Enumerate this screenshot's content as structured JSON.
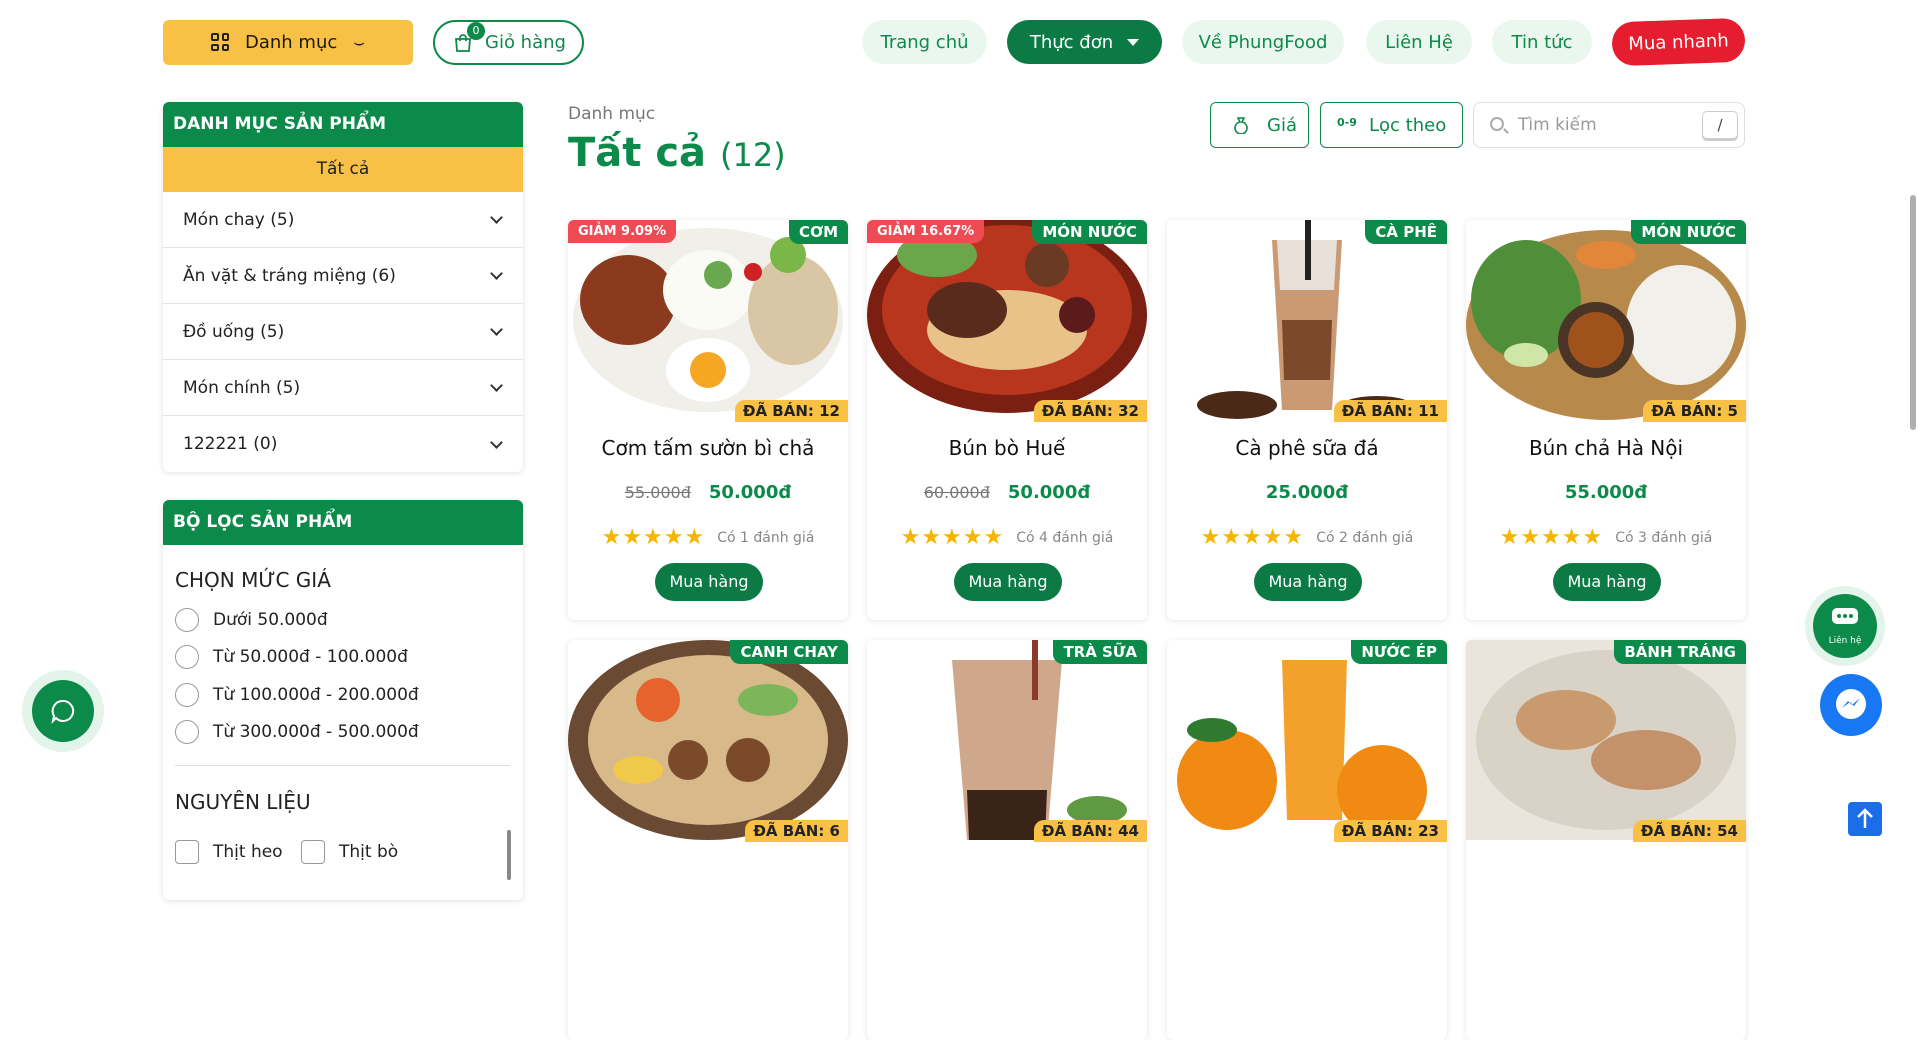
{
  "header": {
    "category_label": "Danh mục",
    "cart_label": "Giỏ hàng",
    "cart_count": "0",
    "nav": [
      {
        "label": "Trang chủ"
      },
      {
        "label": "Thực đơn"
      },
      {
        "label": "Về PhungFood"
      },
      {
        "label": "Liên Hệ"
      },
      {
        "label": "Tin tức"
      },
      {
        "label": "Mua nhanh"
      }
    ]
  },
  "sidebar": {
    "title": "DANH MỤC SẢN PHẨM",
    "all_label": "Tất cả",
    "items": [
      {
        "label": "Món chay (5)"
      },
      {
        "label": "Ăn vặt & tráng miệng (6)"
      },
      {
        "label": "Đồ uống (5)"
      },
      {
        "label": "Món chính (5)"
      },
      {
        "label": "122221 (0)"
      }
    ]
  },
  "filter": {
    "title": "BỘ LỌC SẢN PHẨM",
    "price_title": "CHỌN MỨC GIÁ",
    "price_options": [
      "Dưới 50.000đ",
      "Từ 50.000đ - 100.000đ",
      "Từ 100.000đ - 200.000đ",
      "Từ 300.000đ - 500.000đ"
    ],
    "ingredient_title": "NGUYÊN LIỆU",
    "ingredients": [
      "Thịt heo",
      "Thịt bò"
    ]
  },
  "main": {
    "breadcrumb": "Danh mục",
    "title": "Tất cả",
    "count": "(12)",
    "price_btn": "Giá",
    "sort_btn": "Lọc theo",
    "sort_icon": "0-9",
    "search_placeholder": "Tìm kiếm",
    "search_key": "/"
  },
  "products": [
    {
      "name": "Cơm tấm sườn bì chả",
      "discount": "GIẢM 9.09%",
      "category": "CƠM",
      "sold": "ĐÃ BÁN: 12",
      "old_price": "55.000đ",
      "price": "50.000đ",
      "reviews": "Có 1 đánh giá",
      "buy": "Mua hàng"
    },
    {
      "name": "Bún bò Huế",
      "discount": "GIẢM 16.67%",
      "category": "MÓN NƯỚC",
      "sold": "ĐÃ BÁN: 32",
      "old_price": "60.000đ",
      "price": "50.000đ",
      "reviews": "Có 4 đánh giá",
      "buy": "Mua hàng"
    },
    {
      "name": "Cà phê sữa đá",
      "discount": "",
      "category": "CÀ PHÊ",
      "sold": "ĐÃ BÁN: 11",
      "old_price": "",
      "price": "25.000đ",
      "reviews": "Có 2 đánh giá",
      "buy": "Mua hàng"
    },
    {
      "name": "Bún chả Hà Nội",
      "discount": "",
      "category": "MÓN NƯỚC",
      "sold": "ĐÃ BÁN: 5",
      "old_price": "",
      "price": "55.000đ",
      "reviews": "Có 3 đánh giá",
      "buy": "Mua hàng"
    },
    {
      "category": "CANH CHAY",
      "sold": "ĐÃ BÁN: 6"
    },
    {
      "category": "TRÀ SỮA",
      "sold": "ĐÃ BÁN: 44"
    },
    {
      "category": "NƯỚC ÉP",
      "sold": "ĐÃ BÁN: 23"
    },
    {
      "category": "BÁNH TRÁNG",
      "sold": "ĐÃ BÁN: 54"
    }
  ],
  "stars": "★★★★★",
  "floating": {
    "contact_label": "Liên hệ"
  },
  "colors": {
    "primary": "#0c8a4a",
    "accent": "#f8c045",
    "danger": "#e51d2e"
  }
}
